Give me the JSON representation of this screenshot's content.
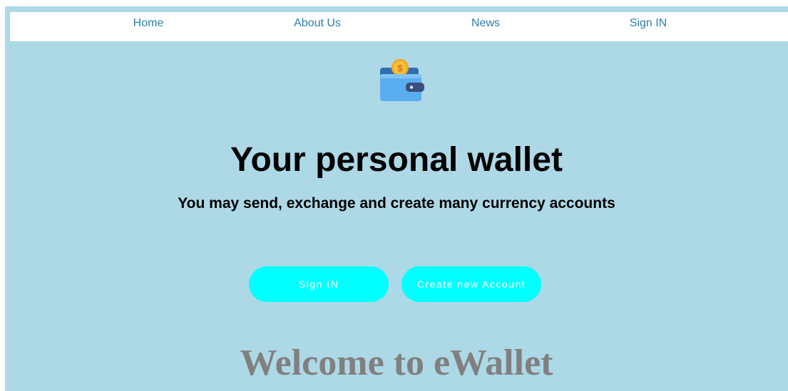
{
  "nav": {
    "items": [
      {
        "label": "Home"
      },
      {
        "label": "About Us"
      },
      {
        "label": "News"
      },
      {
        "label": "Sign IN"
      }
    ]
  },
  "logo": {
    "icon": "wallet-icon"
  },
  "hero": {
    "title": "Your personal wallet",
    "subtitle": "You may send, exchange and create many currency accounts"
  },
  "buttons": {
    "sign_in": "Sign IN",
    "create_account": "Create new Account"
  },
  "welcome": "Welcome to eWallet",
  "colors": {
    "background": "#add8e6",
    "nav_background": "#ffffff",
    "nav_link": "#2c7fa8",
    "button": "#00ffff",
    "button_text": "#ffffff",
    "welcome_text": "#808080"
  }
}
